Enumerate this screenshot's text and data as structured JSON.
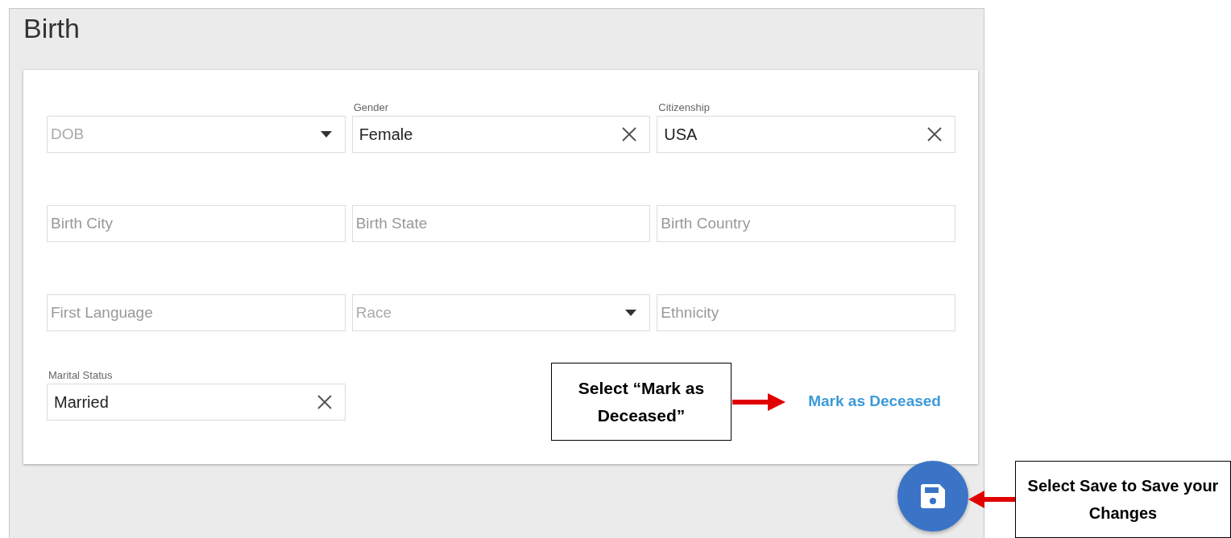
{
  "section": {
    "title": "Birth"
  },
  "rows": [
    [
      {
        "kind": "dropdown",
        "placeholder": "DOB"
      },
      {
        "kind": "clearable",
        "label": "Gender",
        "value": "Female"
      },
      {
        "kind": "clearable",
        "label": "Citizenship",
        "value": "USA"
      }
    ],
    [
      {
        "kind": "text",
        "placeholder": "Birth City"
      },
      {
        "kind": "text",
        "placeholder": "Birth State"
      },
      {
        "kind": "text",
        "placeholder": "Birth Country"
      }
    ],
    [
      {
        "kind": "text",
        "placeholder": "First Language"
      },
      {
        "kind": "dropdown",
        "placeholder": "Race"
      },
      {
        "kind": "text",
        "placeholder": "Ethnicity"
      }
    ],
    [
      {
        "kind": "clearable",
        "label": "Marital Status",
        "value": "Married"
      }
    ]
  ],
  "mark_deceased_link": {
    "label": "Mark as Deceased"
  },
  "callouts": [
    {
      "text": "Select “Mark as Deceased”"
    },
    {
      "text": "Select Save to Save your Changes"
    }
  ]
}
